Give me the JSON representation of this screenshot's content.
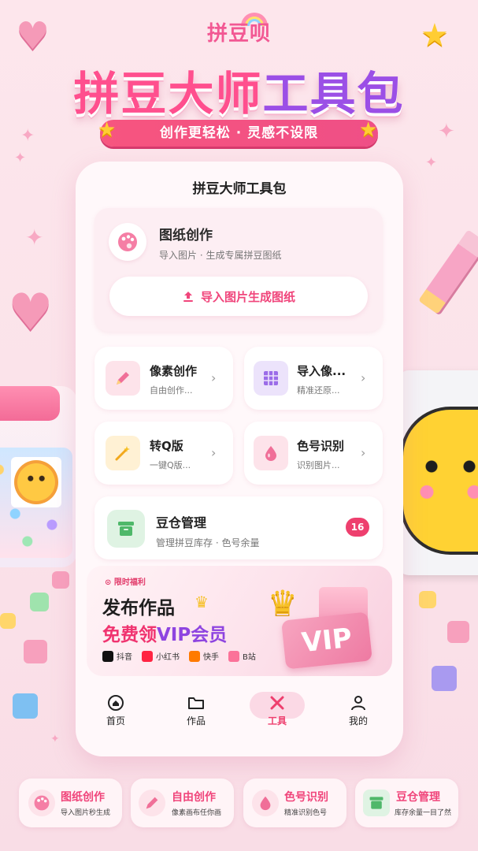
{
  "header": {
    "brand": "拼豆呗",
    "title_part1": "拼豆大师",
    "title_part2": "工具包",
    "tagline": "创作更轻松 · 灵感不设限"
  },
  "app": {
    "screen_title": "拼豆大师工具包",
    "hero": {
      "title": "图纸创作",
      "subtitle": "导入图片 · 生成专属拼豆图纸",
      "button": "导入图片生成图纸",
      "icon": "palette-icon"
    },
    "tiles": [
      {
        "title": "像素创作",
        "subtitle": "自由创作...",
        "icon": "pencil-icon",
        "icon_bg": "#fde3ea"
      },
      {
        "title": "导入像...",
        "subtitle": "精准还原...",
        "icon": "grid-icon",
        "icon_bg": "#ece3fb"
      },
      {
        "title": "转Q版",
        "subtitle": "一键Q版...",
        "icon": "magic-wand-icon",
        "icon_bg": "#fff1d4"
      },
      {
        "title": "色号识别",
        "subtitle": "识别图片...",
        "icon": "color-drop-icon",
        "icon_bg": "#fde3ea"
      }
    ],
    "storage": {
      "title": "豆仓管理",
      "subtitle": "管理拼豆库存 · 色号余量",
      "badge": "16",
      "icon": "storage-box-icon"
    },
    "promo": {
      "tag": "限时福利",
      "line1": "发布作品",
      "line2_a": "免费领",
      "line2_b": "VIP会员",
      "card_text": "VIP",
      "platforms": [
        {
          "name": "抖音",
          "color": "#111111"
        },
        {
          "name": "小红书",
          "color": "#ff2442"
        },
        {
          "name": "快手",
          "color": "#ff7a00"
        },
        {
          "name": "B站",
          "color": "#fb7299"
        }
      ]
    },
    "tabs": [
      {
        "label": "首页",
        "icon": "home-icon",
        "active": false
      },
      {
        "label": "作品",
        "icon": "folder-icon",
        "active": false
      },
      {
        "label": "工具",
        "icon": "tools-icon",
        "active": true
      },
      {
        "label": "我的",
        "icon": "user-icon",
        "active": false
      }
    ]
  },
  "features": [
    {
      "title": "图纸创作",
      "subtitle": "导入图片秒生成",
      "icon": "palette-icon",
      "color": "#f5a0bd"
    },
    {
      "title": "自由创作",
      "subtitle": "像素画布任你画",
      "icon": "pencil-icon",
      "color": "#f5a0bd"
    },
    {
      "title": "色号识别",
      "subtitle": "精准识别色号",
      "icon": "color-drop-icon",
      "color": "#f5a0bd"
    },
    {
      "title": "豆仓管理",
      "subtitle": "库存余量一目了然",
      "icon": "storage-box-icon",
      "color": "#7ccf8e"
    }
  ],
  "colors": {
    "accent": "#f0457b",
    "purple": "#9b4fe6",
    "background": "#fde6ec"
  }
}
